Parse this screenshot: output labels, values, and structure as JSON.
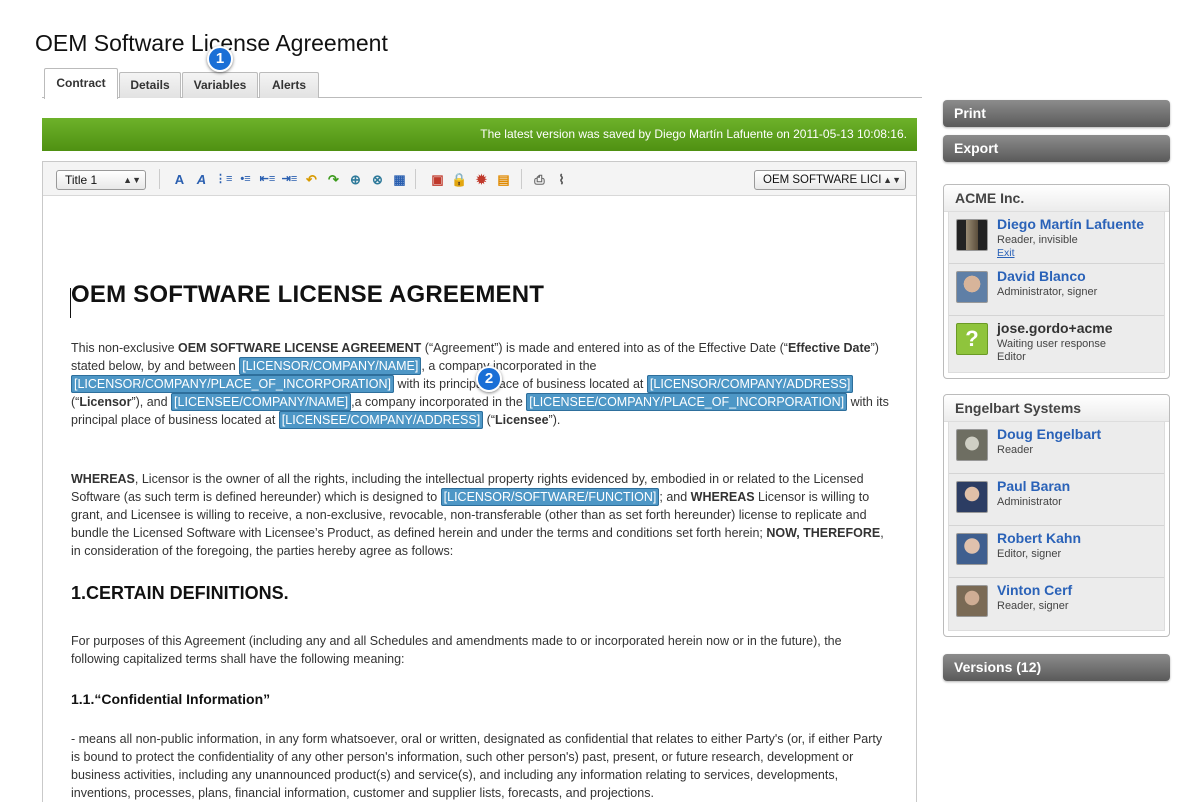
{
  "page": {
    "title": "OEM Software License Agreement"
  },
  "tabs": [
    {
      "label": "Contract",
      "active": true
    },
    {
      "label": "Details",
      "active": false
    },
    {
      "label": "Variables",
      "active": false
    },
    {
      "label": "Alerts",
      "active": false
    }
  ],
  "callouts": [
    "1",
    "2"
  ],
  "save_status": "The latest version was saved by Diego Martín Lafuente on 2011-05-13 10:08:16.",
  "toolbar": {
    "style_select": "Title 1",
    "document_select": "OEM SOFTWARE LICI",
    "icons": [
      "bold-icon",
      "italic-icon",
      "ordered-list-icon",
      "unordered-list-icon",
      "outdent-icon",
      "indent-icon",
      "undo-icon",
      "redo-icon",
      "link-icon",
      "unlink-icon",
      "table-icon",
      "save-icon",
      "lock-icon",
      "seal-icon",
      "archive-icon",
      "print-icon",
      "attachment-icon"
    ]
  },
  "document": {
    "heading": "OEM SOFTWARE LICENSE AGREEMENT",
    "intro": {
      "t1": "This non-exclusive ",
      "b1": "OEM SOFTWARE LICENSE AGREEMENT",
      "t2": " (“Agreement”) is made and entered into as of the Effective Date (“",
      "b2": "Effective Date",
      "t3": "”) stated below, by and between ",
      "v1": "[LICENSOR/COMPANY/NAME]",
      "t4": ", a company incorporated in the ",
      "v2": "[LICENSOR/COMPANY/PLACE_OF_INCORPORATION]",
      "t5": " with its principal place of business located at ",
      "v3": "[LICENSOR/COMPANY/ADDRESS]",
      "t6": " (“",
      "b3": "Licensor",
      "t7": "”), and ",
      "v4": "[LICENSEE/COMPANY/NAME]",
      "t8": ",a company incorporated in the ",
      "v5": "[LICENSEE/COMPANY/PLACE_OF_INCORPORATION]",
      "t9": " with its principal place of business located at ",
      "v6": "[LICENSEE/COMPANY/ADDRESS]",
      "t10": " (“",
      "b4": "Licensee",
      "t11": "”)."
    },
    "whereas": {
      "b1": "WHEREAS",
      "t1": ", Licensor is the owner of all the rights, including the intellectual property rights evidenced by, embodied in or related to the Licensed Software (as such term is defined hereunder) which is designed to ",
      "v1": "[LICENSOR/SOFTWARE/FUNCTION]",
      "t2": "; and ",
      "b2": "WHEREAS",
      "t3": " Licensor is willing to grant, and Licensee is willing to receive, a non-exclusive, revocable, non-transferable (other than as set forth hereunder) license to replicate and bundle the Licensed Software with Licensee’s Product, as defined herein and under the terms and conditions set forth herein; ",
      "b3": "NOW, THEREFORE",
      "t4": ", in consideration of the foregoing, the parties hereby agree as follows:"
    },
    "section1": "1.CERTAIN DEFINITIONS.",
    "section1_text": "For purposes of this Agreement (including any and all Schedules and amendments made to or incorporated herein now or in the future), the following capitalized terms shall have the following meaning:",
    "section11": "1.1.“Confidential Information”",
    "section11_text": "- means all non-public information, in any form whatsoever, oral or written, designated as confidential that relates to either Party's (or, if either Party is bound to protect the confidentiality of any other person's information, such other person's) past, present, or future research, development or business activities, including any unannounced product(s) and service(s), and including any information relating to services, developments, inventions, processes, plans, financial information, customer and supplier lists, forecasts, and projections."
  },
  "sidebar": {
    "print": "Print",
    "export": "Export",
    "versions": "Versions (12)",
    "groups": [
      {
        "name": "ACME Inc.",
        "users": [
          {
            "name": "Diego Martín Lafuente",
            "role": "Reader, invisible",
            "link": "Exit"
          },
          {
            "name": "David Blanco",
            "role": "Administrator, signer"
          },
          {
            "name": "jose.gordo+acme",
            "role": "Waiting user response",
            "role2": "Editor"
          }
        ]
      },
      {
        "name": "Engelbart Systems",
        "users": [
          {
            "name": "Doug Engelbart",
            "role": "Reader"
          },
          {
            "name": "Paul Baran",
            "role": "Administrator"
          },
          {
            "name": "Robert Kahn",
            "role": "Editor, signer"
          },
          {
            "name": "Vinton Cerf",
            "role": "Reader, signer"
          }
        ]
      }
    ]
  },
  "colors": {
    "savebar": "#5aa01b",
    "variable": "#4e97c6",
    "link": "#2a62b8",
    "badge": "#1a6fd6"
  }
}
